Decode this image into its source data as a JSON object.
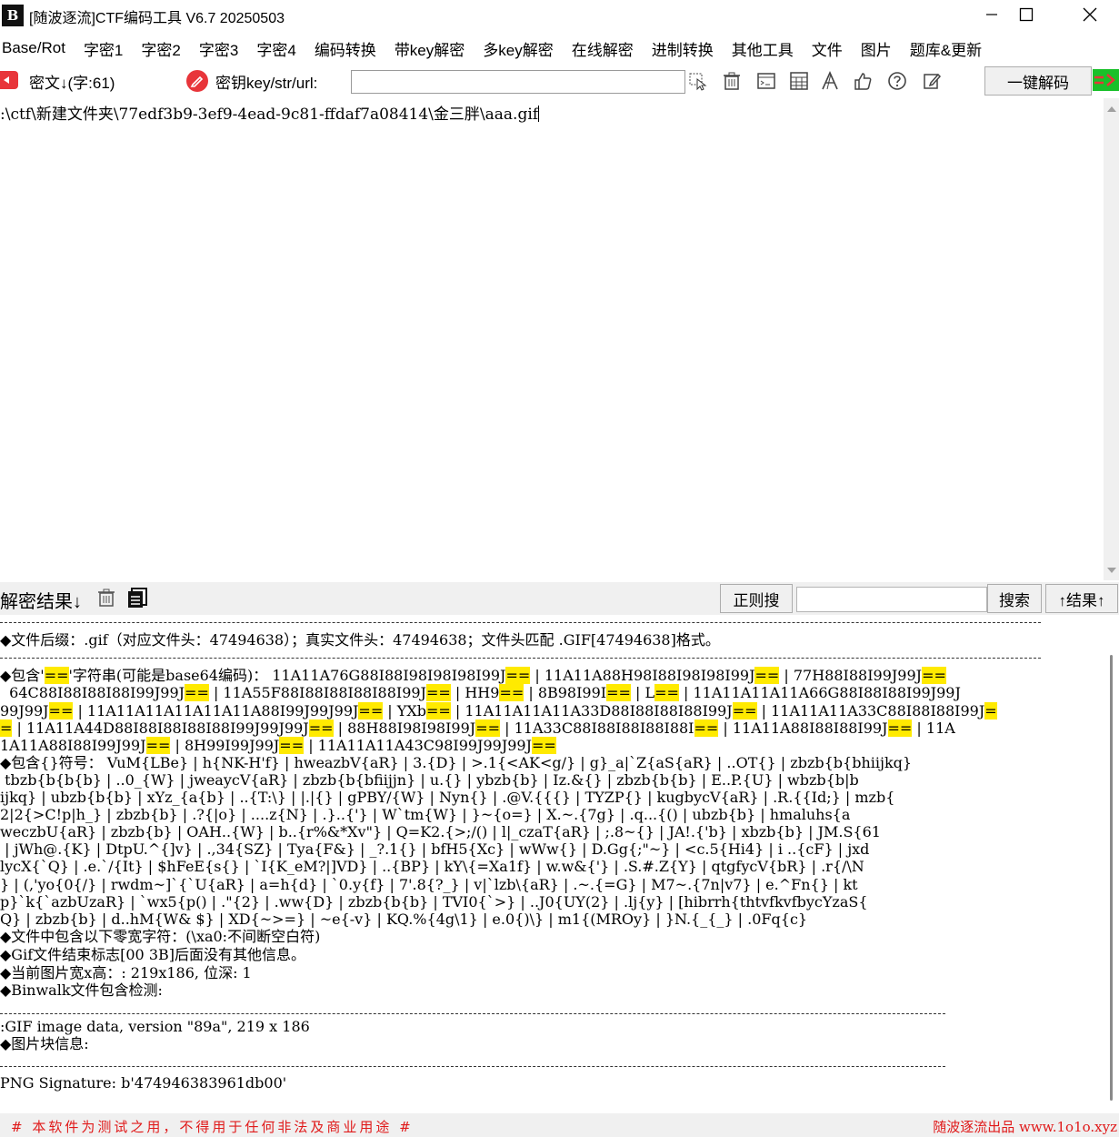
{
  "window": {
    "logo_text": "B",
    "title": "[随波逐流]CTF编码工具 V6.7  20250503"
  },
  "menu": {
    "items": [
      "Base/Rot",
      "字密1",
      "字密2",
      "字密3",
      "字密4",
      "编码转换",
      "带key解密",
      "多key解密",
      "在线解密",
      "进制转换",
      "其他工具",
      "文件",
      "图片",
      "题库&更新"
    ]
  },
  "toolbar": {
    "cipher_label": "密文↓(字:61)",
    "key_label": "密钥key/str/url:",
    "key_value": "",
    "decode_button": "一键解码"
  },
  "input": {
    "text": ":\\ctf\\新建文件夹\\77edf3b9-3ef9-4ead-9c81-ffdaf7a08414\\金三胖\\aaa.gif"
  },
  "result_bar": {
    "label": "解密结果↓",
    "regex_button": "正则搜",
    "search_value": "",
    "search_button": "搜索",
    "result_up_button": "↑结果↑"
  },
  "result": {
    "lines": [
      [
        {
          "t": "◆文件后缀：.gif（对应文件头：47494638）；真实文件头：47494638；文件头匹配 .GIF[47494638]格式。"
        }
      ],
      [
        {
          "t": "◆包含'"
        },
        {
          "t": "==",
          "h": true
        },
        {
          "t": "'字符串(可能是base64编码)： 11A11A76G88I88I98I98I98I99J"
        },
        {
          "t": "==",
          "h": true
        },
        {
          "t": " | 11A11A88H98I88I98I98I99J"
        },
        {
          "t": "==",
          "h": true
        },
        {
          "t": " | 77H88I88I99J99J"
        },
        {
          "t": "==",
          "h": true
        }
      ],
      [
        {
          "t": "  64C88I88I88I88I99J99J"
        },
        {
          "t": "==",
          "h": true
        },
        {
          "t": " | 11A55F88I88I88I88I88I99J"
        },
        {
          "t": "==",
          "h": true
        },
        {
          "t": " | HH9"
        },
        {
          "t": "==",
          "h": true
        },
        {
          "t": " | 8B98I99I"
        },
        {
          "t": "==",
          "h": true
        },
        {
          "t": " | L"
        },
        {
          "t": "==",
          "h": true
        },
        {
          "t": " | 11A11A11A11A66G88I88I88I99J99J"
        }
      ],
      [
        {
          "t": "99J99J"
        },
        {
          "t": "==",
          "h": true
        },
        {
          "t": " | 11A11A11A11A11A11A88I99J99J99J"
        },
        {
          "t": "==",
          "h": true
        },
        {
          "t": " | YXb"
        },
        {
          "t": "==",
          "h": true
        },
        {
          "t": " | 11A11A11A11A33D88I88I88I88I99J"
        },
        {
          "t": "==",
          "h": true
        },
        {
          "t": " | 11A11A11A33C88I88I88I99J"
        },
        {
          "t": "=",
          "h": true
        }
      ],
      [
        {
          "t": "=",
          "h": true
        },
        {
          "t": " | 11A11A44D88I88I88I88I88I99J99J99J"
        },
        {
          "t": "==",
          "h": true
        },
        {
          "t": " | 88H88I98I98I99J"
        },
        {
          "t": "==",
          "h": true
        },
        {
          "t": " | 11A33C88I88I88I88I88I"
        },
        {
          "t": "==",
          "h": true
        },
        {
          "t": " | 11A11A88I88I88I99J"
        },
        {
          "t": "==",
          "h": true
        },
        {
          "t": " | 11A"
        }
      ],
      [
        {
          "t": "1A11A88I88I99J99J"
        },
        {
          "t": "==",
          "h": true
        },
        {
          "t": " | 8H99I99J99J"
        },
        {
          "t": "==",
          "h": true
        },
        {
          "t": " | 11A11A11A43C98I99J99J99J"
        },
        {
          "t": "==",
          "h": true
        }
      ],
      [
        {
          "t": "◆包含{}符号： VuM{LBe} | h{NK-H'f} | hweazbV{aR} | 3.{D} | >.1{<AK<g/} | g}_a|`Z{aS{aR} | ..OT{} | zbzb{b{bhiijkq}"
        }
      ],
      [
        {
          "t": " tbzb{b{b{b} | ..0_{W} | jweaycV{aR} | zbzb{b{bfiijjn} | u.{} | ybzb{b} | Iz.&{} | zbzb{b{b} | E..P.{U} | wbzb{b|b"
        }
      ],
      [
        {
          "t": "ijkq} | ubzb{b{b} | xYz_{a{b} | ..{T:\\} | |.|{} | gPBY/{W} | Nyn{} | .@V.{{{} | TYZP{} | kugbycV{aR} | .R.{{Id;} | mzb{"
        }
      ],
      [
        {
          "t": "2|2{>C!p|h_} | zbzb{b} | .?{|o} | ....z{N} | .}..{'} | W`tm{W} | }~{o=} | X.~.{7g} | .q...{() | ubzb{b} | hmaluhs{a"
        }
      ],
      [
        {
          "t": "weczbU{aR} | zbzb{b} | OAH..{W} | b..{r%&*Xv\"} | Q=K2.{>;/() | l|_czaT{aR} | ;.8~{} | JA!.{'b} | xbzb{b} | JM.S{61"
        }
      ],
      [
        {
          "t": " | jWh@.{K} | DtpU.^{]v} | .,34{SZ} | Tya{F&} | _?.1{} | bfH5{Xc} | wWw{} | D.Gg{;\"~} | <c.5{Hi4} | i ..{cF} | jxd"
        }
      ],
      [
        {
          "t": "lycX{`Q} | .e.`/{It} | $hFeE{s{} | `I{K_eM?|]VD} | ..{BP} | kY\\{=Xa1f} | w.w&{'} | .S.#.Z{Y} | qtgfycV{bR} | .r{/\\N"
        }
      ],
      [
        {
          "t": "} | (,'yo{0{/} | rwdm~]`{`U{aR} | a=h{d} | `0.y{f} | 7'.8{?_} | v|`lzb\\{aR} | .~.{=G} | M7~.{7n|v7} | e.^Fn{} | kt"
        }
      ],
      [
        {
          "t": "p}`k{`azbUzaR} | `wx5{p() | .\"{2} | .ww{D} | zbzb{b{b} | TVI0{`>} | ..J0{UY(2} | .lj{y} | [hibrrh{thtvfkvfbycYzaS{"
        }
      ],
      [
        {
          "t": "Q} | zbzb{b} | d..hM{W& $} | XD{~>=} | ~e{-v} | KQ.%{4g\\1} | e.0{)\\} | m1{(MROy} | }N.{_{_} | .0Fq{c}"
        }
      ],
      [
        {
          "t": "◆文件中包含以下零宽字符：(\\xa0:不间断空白符)"
        }
      ],
      [
        {
          "t": "◆Gif文件结束标志[00 3B]后面没有其他信息。"
        }
      ],
      [
        {
          "t": "◆当前图片宽x高：: 219x186, 位深: 1"
        }
      ],
      [
        {
          "t": "◆Binwalk文件包含检测:"
        }
      ],
      [
        {
          "t": " "
        }
      ],
      [
        {
          "t": ":GIF image data, version \"89a\", 219 x 186"
        }
      ],
      [
        {
          "t": "◆图片块信息:"
        }
      ],
      [
        {
          "t": " "
        }
      ],
      [
        {
          "t": "PNG Signature: b'474946383961db00'"
        }
      ]
    ]
  },
  "footer": {
    "left": "# 本软件为测试之用，不得用于任何非法及商业用途 #",
    "right": "随波逐流出品 www.1o1o.xyz"
  },
  "colors": {
    "highlight": "#ffea00",
    "footer_text": "#e01a1a",
    "accent_red": "#e8353a"
  }
}
